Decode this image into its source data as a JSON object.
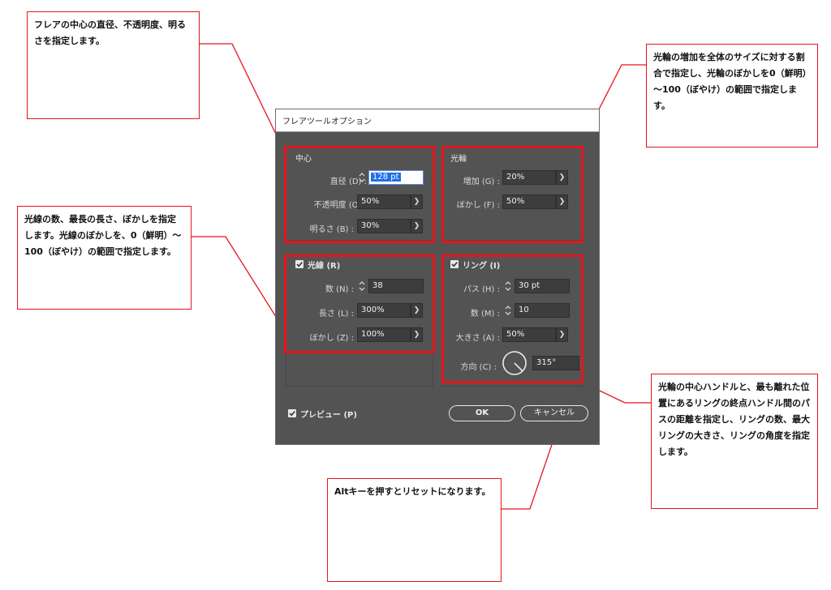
{
  "dialog": {
    "title": "フレアツールオプション",
    "center": {
      "title": "中心",
      "diameter_label": "直径 (D) :",
      "diameter_value": "128 pt",
      "opacity_label": "不透明度 (O) :",
      "opacity_value": "50%",
      "brightness_label": "明るさ (B) :",
      "brightness_value": "30%"
    },
    "halo": {
      "title": "光輪",
      "growth_label": "増加 (G) :",
      "growth_value": "20%",
      "fuzziness_label": "ぼかし (F) :",
      "fuzziness_value": "50%"
    },
    "rays": {
      "checkbox_label": "光線 (R)",
      "checked": true,
      "number_label": "数 (N) :",
      "number_value": "38",
      "longest_label": "長さ (L) :",
      "longest_value": "300%",
      "fuzziness_label": "ぼかし (Z) :",
      "fuzziness_value": "100%"
    },
    "rings": {
      "checkbox_label": "リング (I)",
      "checked": true,
      "path_label": "パス (H) :",
      "path_value": "30 pt",
      "number_label": "数 (M) :",
      "number_value": "10",
      "largest_label": "大きさ (A) :",
      "largest_value": "50%",
      "direction_label": "方向 (C) :",
      "direction_value": "315°"
    },
    "preview_label": "プレビュー (P)",
    "preview_checked": true,
    "ok_label": "OK",
    "cancel_label": "キャンセル"
  },
  "callouts": {
    "center": "フレアの中心の直径、不透明度、明るさを指定します。",
    "halo": "光輪の増加を全体のサイズに対する割合で指定し、光輪のぼかしを0（鮮明）～100（ぼやけ）の範囲で指定します。",
    "rays": "光線の数、最長の長さ、ぼかしを指定します。光線のぼかしを、0（鮮明）～100（ぼやけ）の範囲で指定します。",
    "rings": "光輪の中心ハンドルと、最も離れた位置にあるリングの終点ハンドル間のパスの距離を指定し、リングの数、最大リングの大きさ、リングの角度を指定します。",
    "alt": "Altキーを押すとリセットになります。"
  },
  "colors": {
    "annotation_red": "#e8141b",
    "dialog_bg": "#535353",
    "selection_blue": "#1f6fe5"
  }
}
